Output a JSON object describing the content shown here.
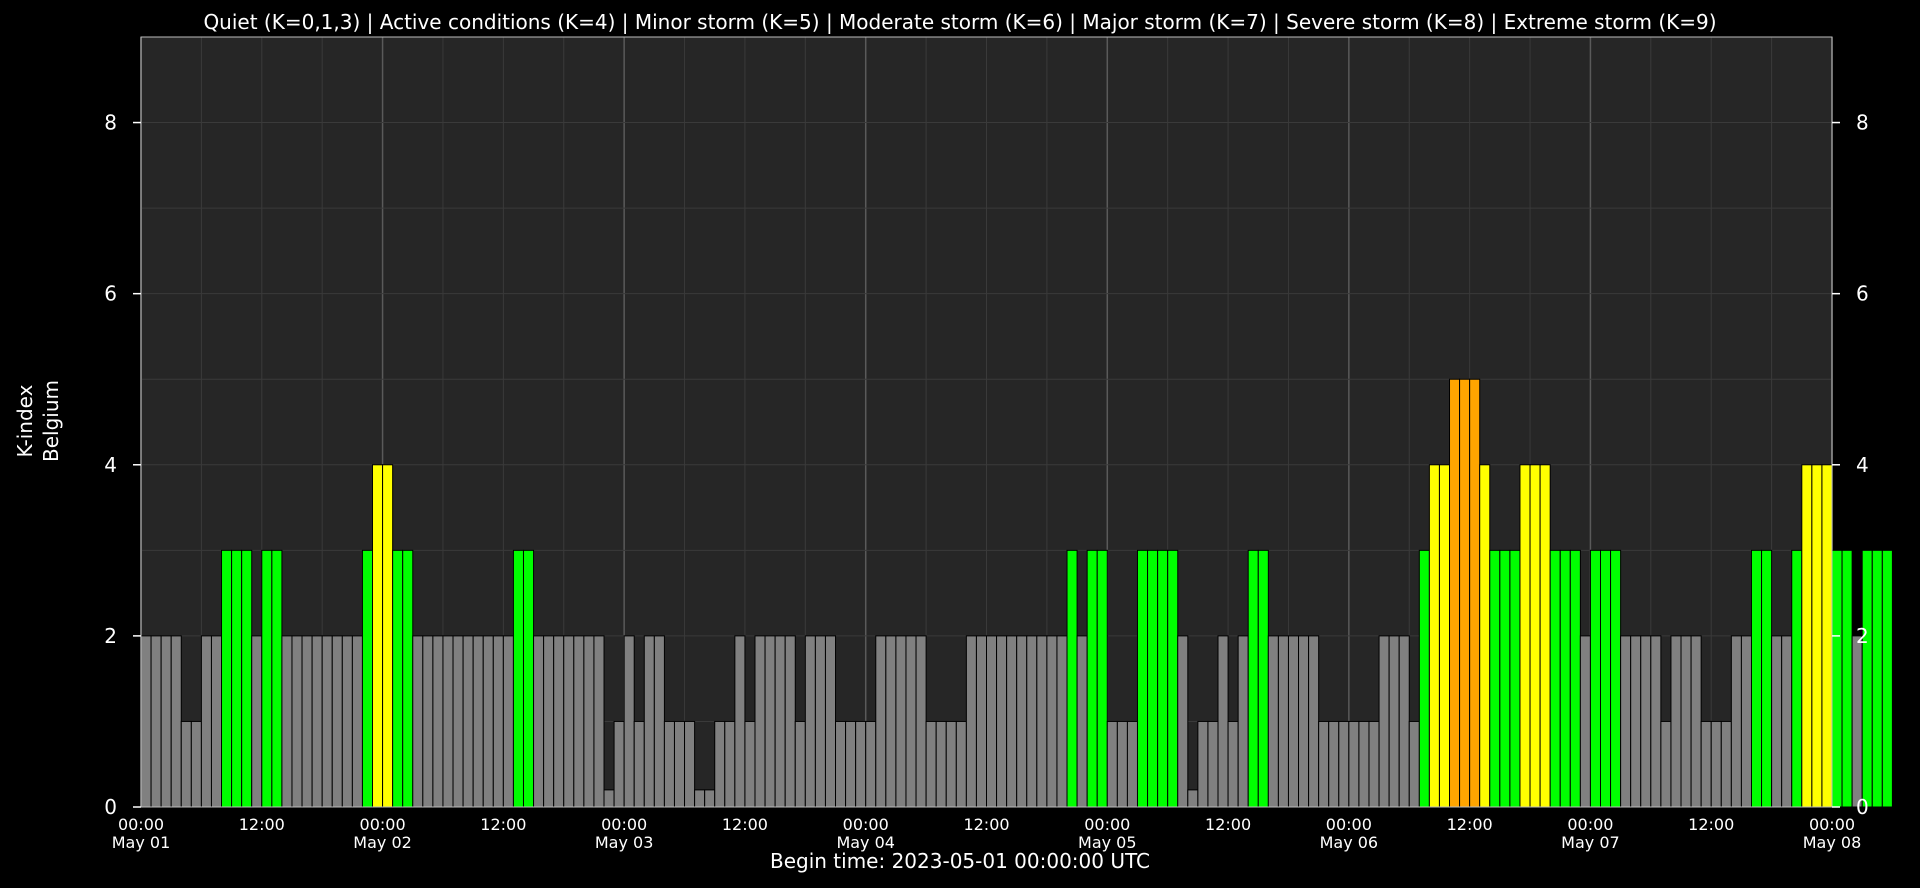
{
  "chart_data": {
    "type": "bar",
    "title": "Quiet (K=0,1,3) | Active conditions (K=4) | Minor storm (K=5) | Moderate storm (K=6) | Major storm (K=7) | Severe storm (K=8) | Extreme storm (K=9)",
    "xlabel": "Begin time: 2023-05-01 00:00:00 UTC",
    "ylabel_lines": [
      "K-index",
      "Belgium"
    ],
    "ylim": [
      0,
      9
    ],
    "y_ticks": [
      "0",
      "2",
      "4",
      "6",
      "8"
    ],
    "x_tick_labels": [
      {
        "time": "00:00",
        "date": "May 01"
      },
      {
        "time": "12:00",
        "date": ""
      },
      {
        "time": "00:00",
        "date": "May 02"
      },
      {
        "time": "12:00",
        "date": ""
      },
      {
        "time": "00:00",
        "date": "May 03"
      },
      {
        "time": "12:00",
        "date": ""
      },
      {
        "time": "00:00",
        "date": "May 04"
      },
      {
        "time": "12:00",
        "date": ""
      },
      {
        "time": "00:00",
        "date": "May 05"
      },
      {
        "time": "12:00",
        "date": ""
      },
      {
        "time": "00:00",
        "date": "May 06"
      },
      {
        "time": "12:00",
        "date": ""
      },
      {
        "time": "00:00",
        "date": "May 07"
      },
      {
        "time": "12:00",
        "date": ""
      },
      {
        "time": "00:00",
        "date": "May 08"
      }
    ],
    "x_start": "2023-05-01 00:00",
    "x_end": "2023-05-08 00:00",
    "bar_interval_hours": 1,
    "grid": true,
    "colors": {
      "background": "#000000",
      "plot_background": "#262626",
      "grid_minor": "#3a3a3a",
      "grid_major": "#5a5a5a",
      "bar_outline": "#000000",
      "k_0_2": "#808080",
      "k_3": "#00ff00",
      "k_4": "#ffff00",
      "k_5": "#ffa500"
    },
    "values": [
      2,
      2,
      2,
      2,
      1,
      1,
      2,
      2,
      3,
      3,
      3,
      2,
      3,
      3,
      2,
      2,
      2,
      2,
      2,
      2,
      2,
      2,
      3,
      4,
      4,
      3,
      3,
      2,
      2,
      2,
      2,
      2,
      2,
      2,
      2,
      2,
      2,
      3,
      3,
      2,
      2,
      2,
      2,
      2,
      2,
      2,
      0.2,
      1,
      2,
      1,
      2,
      2,
      1,
      1,
      1,
      0.2,
      0.2,
      1,
      1,
      2,
      1,
      2,
      2,
      2,
      2,
      1,
      2,
      2,
      2,
      1,
      1,
      1,
      1,
      2,
      2,
      2,
      2,
      2,
      1,
      1,
      1,
      1,
      2,
      2,
      2,
      2,
      2,
      2,
      2,
      2,
      2,
      2,
      3,
      2,
      3,
      3,
      1,
      1,
      1,
      3,
      3,
      3,
      3,
      2,
      0.2,
      1,
      1,
      2,
      1,
      2,
      3,
      3,
      2,
      2,
      2,
      2,
      2,
      1,
      1,
      1,
      1,
      1,
      1,
      2,
      2,
      2,
      1,
      3,
      4,
      4,
      5,
      5,
      5,
      4,
      3,
      3,
      3,
      4,
      4,
      4,
      3,
      3,
      3,
      2,
      3,
      3,
      3,
      2,
      2,
      2,
      2,
      1,
      2,
      2,
      2,
      1,
      1,
      1,
      2,
      2,
      3,
      3,
      2,
      2,
      3,
      4,
      4,
      4,
      3,
      3,
      2,
      3,
      3,
      3
    ]
  }
}
